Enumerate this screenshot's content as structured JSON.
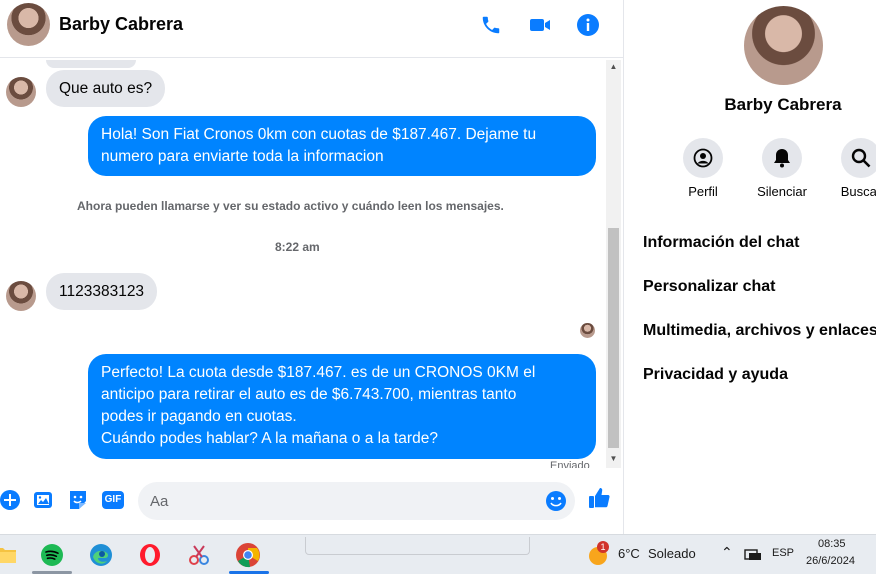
{
  "contact": {
    "name": "Barby Cabrera"
  },
  "messages": {
    "incoming_1": "Que auto es?",
    "outgoing_1": "Hola! Son Fiat Cronos 0km con cuotas de $187.467. Dejame tu numero para enviarte toda la informacion",
    "system_notice": "Ahora pueden llamarse y ver su estado activo y cuándo leen los mensajes.",
    "timestamp": "8:22 am",
    "incoming_2": "1123383123",
    "outgoing_2_lines": [
      "Perfecto! La cuota desde $187.467. es de un CRONOS 0KM el",
      "anticipo para retirar el auto es de $6.743.700, mientras tanto",
      "podes ir pagando en cuotas.",
      "Cuándo podes hablar? A la mañana o a la tarde?"
    ],
    "sent_status": "Enviado"
  },
  "composer": {
    "placeholder": "Aa",
    "gif_label": "GIF"
  },
  "side_panel": {
    "name": "Barby Cabrera",
    "actions": [
      {
        "label": "Perfil",
        "icon": "profile-icon"
      },
      {
        "label": "Silenciar",
        "icon": "bell-icon"
      },
      {
        "label": "Buscar",
        "icon": "search-icon"
      }
    ],
    "menu": [
      "Información del chat",
      "Personalizar chat",
      "Multimedia, archivos y enlaces",
      "Privacidad y ayuda"
    ]
  },
  "taskbar": {
    "weather_temp": "6°C",
    "weather_text": "Soleado",
    "weather_badge": "1",
    "language": "ESP",
    "time": "08:35",
    "date": "26/6/2024"
  },
  "colors": {
    "accent": "#0084ff",
    "incoming_bubble": "#e4e6eb",
    "messenger_icon": "#0a7cff"
  }
}
